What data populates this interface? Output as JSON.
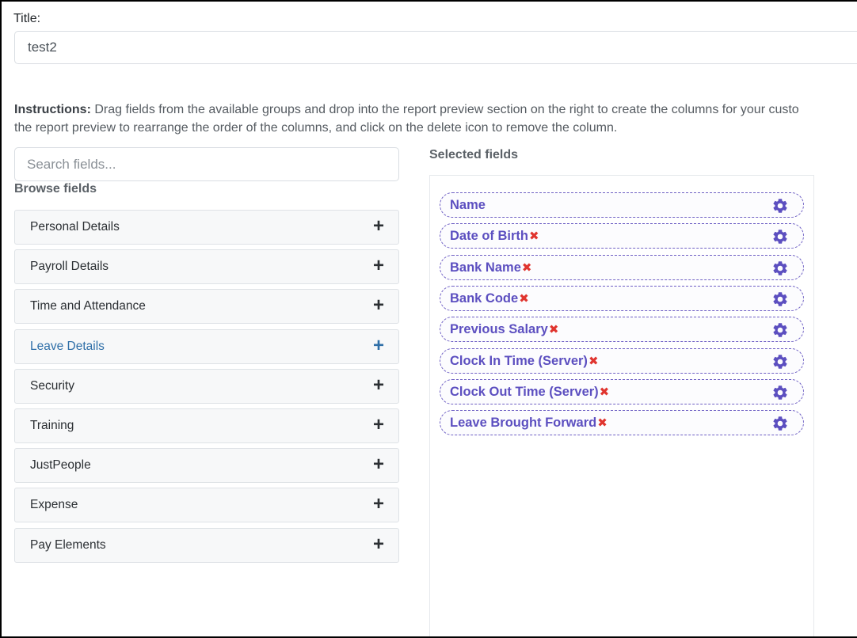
{
  "title": {
    "label": "Title:",
    "value": "test2"
  },
  "instructions": {
    "bold": "Instructions:",
    "line1": " Drag fields from the available groups and drop into the report preview section on the right to create the columns for your custo",
    "line2": "the report preview to rearrange the order of the columns, and click on the delete icon to remove the column."
  },
  "search": {
    "placeholder": "Search fields..."
  },
  "browse": {
    "label": "Browse fields",
    "groups": [
      {
        "label": "Personal Details",
        "icon": "+",
        "icon_name": "plus-icon"
      },
      {
        "label": "Payroll Details",
        "icon": "+",
        "icon_name": "plus-icon"
      },
      {
        "label": "Time and Attendance",
        "icon": "+",
        "icon_name": "plus-icon"
      },
      {
        "label": "Leave Details",
        "icon": "+",
        "icon_name": "plus-icon"
      },
      {
        "label": "Security",
        "icon": "+",
        "icon_name": "plus-icon"
      },
      {
        "label": "Training",
        "icon": "+",
        "icon_name": "plus-icon"
      },
      {
        "label": "JustPeople",
        "icon": "+",
        "icon_name": "plus-icon"
      },
      {
        "label": "Expense",
        "icon": "+",
        "icon_name": "plus-icon"
      },
      {
        "label": "Pay Elements",
        "icon": "+",
        "icon_name": "plus-icon"
      }
    ],
    "active_group": "Leave Details"
  },
  "selected": {
    "label": "Selected fields",
    "delete_icon": "✖",
    "fields": [
      {
        "label": "Name",
        "deletable": false
      },
      {
        "label": "Date of Birth",
        "deletable": true
      },
      {
        "label": "Bank Name",
        "deletable": true
      },
      {
        "label": "Bank Code",
        "deletable": true
      },
      {
        "label": "Previous Salary",
        "deletable": true
      },
      {
        "label": "Clock In Time (Server)",
        "deletable": true
      },
      {
        "label": "Clock Out Time (Server)",
        "deletable": true
      },
      {
        "label": "Leave Brought Forward",
        "deletable": true
      }
    ]
  },
  "colors": {
    "chip_text": "#5c4fc0",
    "delete": "#e0352f",
    "active_group": "#2f6fa8",
    "gear": "#5c4fc0"
  }
}
